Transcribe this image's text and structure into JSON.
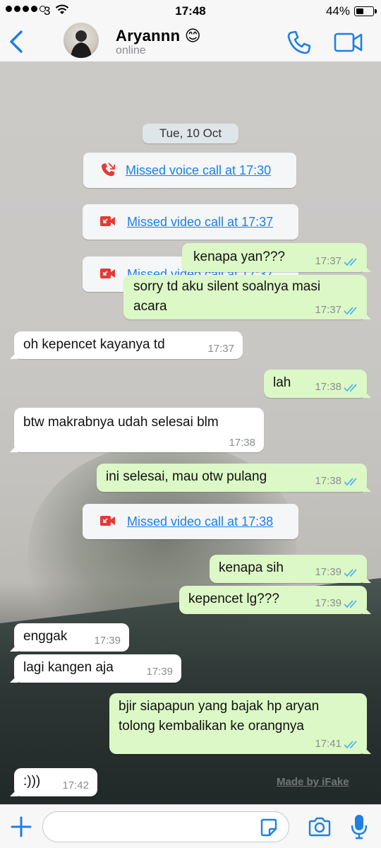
{
  "status_bar": {
    "carrier": "3",
    "time": "17:48",
    "battery": "44%"
  },
  "header": {
    "name": "Aryannn 😊",
    "status": "online"
  },
  "chat": {
    "date": "Tue, 10 Oct",
    "system": [
      {
        "text": "Missed voice call at 17:30",
        "icon": "missed-voice-call-icon"
      },
      {
        "text": "Missed video call at 17:37",
        "icon": "missed-video-call-icon"
      },
      {
        "text": "Missed video call at 17:37",
        "icon": "missed-video-call-icon"
      },
      {
        "text": "Missed video call at 17:38",
        "icon": "missed-video-call-icon"
      }
    ],
    "messages": [
      {
        "dir": "out",
        "text": "kenapa yan???",
        "time": "17:37"
      },
      {
        "dir": "out",
        "text": "sorry td aku silent soalnya masi",
        "text2": "acara",
        "time": "17:37"
      },
      {
        "dir": "in",
        "text": "oh kepencet kayanya td",
        "time": "17:37"
      },
      {
        "dir": "out",
        "text": "lah",
        "time": "17:38"
      },
      {
        "dir": "in",
        "text": "btw makrabnya udah selesai blm",
        "time": "17:38"
      },
      {
        "dir": "out",
        "text": "ini selesai, mau otw pulang",
        "time": "17:38"
      },
      {
        "dir": "out",
        "text": "kenapa sih",
        "time": "17:39"
      },
      {
        "dir": "out",
        "text": "kepencet lg???",
        "time": "17:39"
      },
      {
        "dir": "in",
        "text": "enggak",
        "time": "17:39"
      },
      {
        "dir": "in",
        "text": "lagi kangen aja",
        "time": "17:39"
      },
      {
        "dir": "out",
        "text": "bjir siapapun yang bajak hp aryan",
        "text2": "tolong kembalikan ke orangnya",
        "time": "17:41"
      },
      {
        "dir": "in",
        "text": ":)))",
        "time": "17:42"
      }
    ],
    "watermark": "Made by iFake"
  },
  "input": {
    "value": ""
  },
  "colors": {
    "accent": "#1f7fe4",
    "outgoing": "#dcf8c6",
    "incoming": "#ffffff",
    "missed": "#e53935",
    "read_ticks": "#4fb6ec"
  }
}
